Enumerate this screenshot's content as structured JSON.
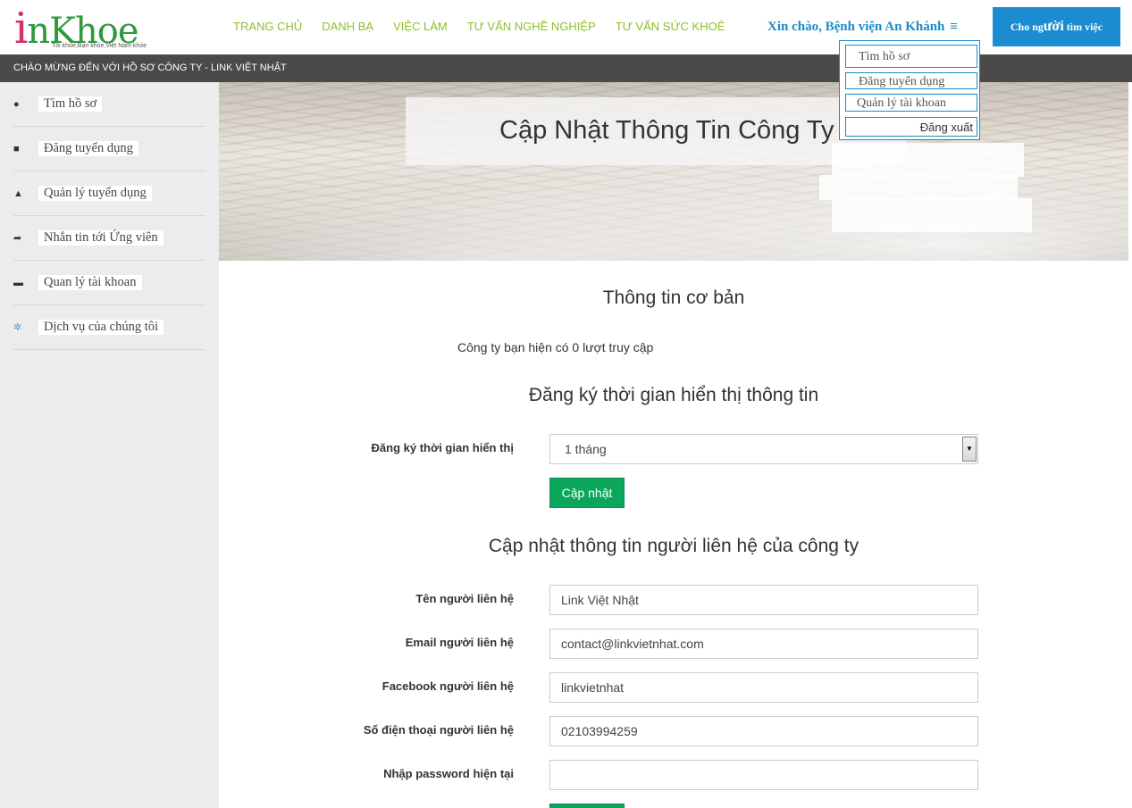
{
  "header": {
    "logo_mark": "i",
    "logo_text": "nKhoe",
    "logo_tagline": "Tôi khỏe,Bạn khỏe,Việt Nam khỏe",
    "nav": [
      "TRANG CHỦ",
      "DANH BẠ",
      "VIỆC LÀM",
      "TƯ VẤN NGHỀ NGHIỆP",
      "TƯ VẤN SỨC KHOẺ"
    ],
    "greeting": "Xin chào, Bệnh viện An Khánh",
    "menu_icon": "≡",
    "cta_prefix": "Cho ng",
    "cta_big": "ười",
    "cta_suffix": " tìm việc"
  },
  "welcome_bar": "CHÀO MỪNG ĐẾN VỚI HỒ SƠ CÔNG TY - LINK VIỆT NHẬT",
  "sidebar": {
    "items": [
      {
        "label": "Tìm hồ sơ",
        "icon": "user-icon",
        "glyph": "●"
      },
      {
        "label": "Đăng tuyển dụng",
        "icon": "bookmark-icon",
        "glyph": "■"
      },
      {
        "label": "Quản lý tuyển dụng",
        "icon": "home-icon",
        "glyph": "▲"
      },
      {
        "label": "Nhắn tin tới Ứng viên",
        "icon": "share-icon",
        "glyph": "➦"
      },
      {
        "label": "Quan lý tài khoan",
        "icon": "book-icon",
        "glyph": "▬"
      },
      {
        "label": "Dịch vụ của chúng tôi",
        "icon": "gears-icon",
        "glyph": "✲"
      }
    ]
  },
  "banner": {
    "title": "Cập Nhật Thông Tin Công Ty"
  },
  "dropdown": {
    "items": [
      "Tìm hồ sơ",
      "Đăng tuyển dụng",
      "Quản lý tài khoan",
      "Đăng xuất"
    ]
  },
  "main": {
    "basic_heading": "Thông tin cơ bản",
    "visit_text": "Công ty bạn hiện có 0 lượt truy cập",
    "register_heading": "Đăng ký thời gian hiển thị thông tin",
    "register_label": "Đăng ký thời gian hiển thị",
    "register_value": "1 tháng",
    "update_button": "Cập nhật",
    "contact_heading": "Cập nhật thông tin người liên hệ của công ty",
    "fields": [
      {
        "label": "Tên người liên hệ",
        "value": "Link Việt Nhật"
      },
      {
        "label": "Email người liên hệ",
        "value": "contact@linkvietnhat.com"
      },
      {
        "label": "Facebook người liên hệ",
        "value": "linkvietnhat"
      },
      {
        "label": "Số điện thoại người liên hệ",
        "value": "02103994259"
      },
      {
        "label": "Nhập password hiện tại",
        "value": ""
      }
    ]
  },
  "colors": {
    "nav_green": "#8dbf2d",
    "brand_blue": "#1a8bc8",
    "button_green": "#0aa65a",
    "welcome_bar": "#4a4a4a",
    "sidebar_bg": "#ececec"
  }
}
